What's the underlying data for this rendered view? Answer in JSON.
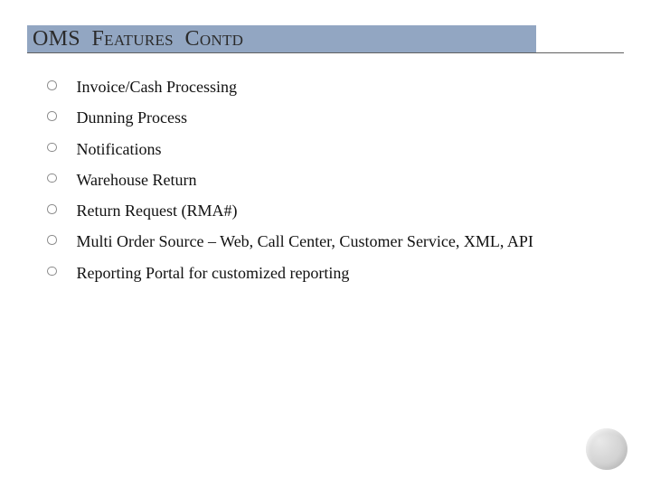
{
  "title": {
    "word1": "OMS",
    "word2": "Features",
    "word3": "Contd"
  },
  "features": {
    "items": [
      {
        "label": "Invoice/Cash Processing"
      },
      {
        "label": "Dunning Process"
      },
      {
        "label": "Notifications"
      },
      {
        "label": "Warehouse Return"
      },
      {
        "label": "Return Request (RMA#)"
      },
      {
        "label": "Multi Order Source – Web, Call Center, Customer Service, XML, API"
      },
      {
        "label": "Reporting Portal for customized reporting"
      }
    ]
  }
}
